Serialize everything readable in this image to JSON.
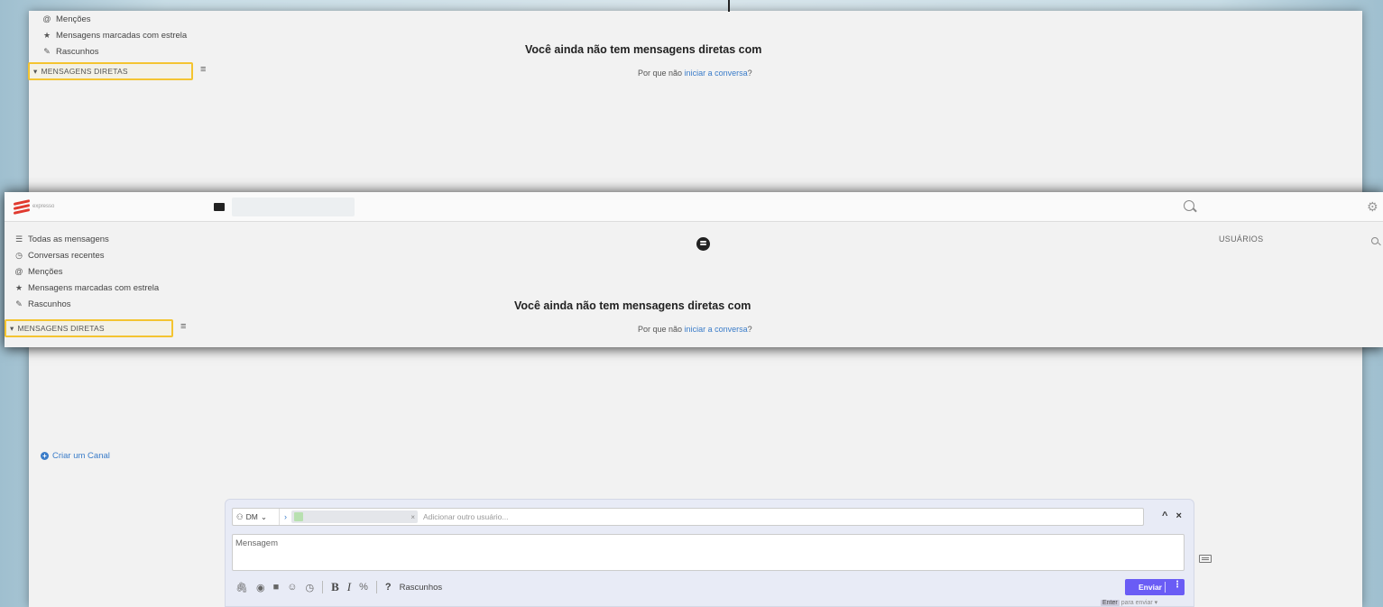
{
  "background": {
    "nav": [
      {
        "icon": "at-icon",
        "glyph": "@",
        "label": "Menções"
      },
      {
        "icon": "star-icon",
        "glyph": "★",
        "label": "Mensagens marcadas com estrela"
      },
      {
        "icon": "pencil-icon",
        "glyph": "✎",
        "label": "Rascunhos"
      }
    ],
    "dm_header": "MENSAGENS DIRETAS",
    "empty_title": "Você ainda não tem mensagens diretas com",
    "empty_prefix": "Por que não",
    "empty_link": "iniciar a conversa",
    "empty_suffix": "?"
  },
  "overlay": {
    "logo_text": "expresso",
    "nav": [
      {
        "icon": "list-icon",
        "glyph": "☰",
        "label": "Todas as mensagens"
      },
      {
        "icon": "clock-icon",
        "glyph": "◷",
        "label": "Conversas recentes"
      },
      {
        "icon": "at-icon",
        "glyph": "@",
        "label": "Menções"
      },
      {
        "icon": "star-icon",
        "glyph": "★",
        "label": "Mensagens marcadas com estrela"
      },
      {
        "icon": "pencil-icon",
        "glyph": "✎",
        "label": "Rascunhos"
      }
    ],
    "dm_header": "MENSAGENS DIRETAS",
    "users_label": "USUÁRIOS",
    "empty_title": "Você ainda não tem mensagens diretas com",
    "empty_prefix": "Por que não",
    "empty_link": "iniciar a conversa",
    "empty_suffix": "?"
  },
  "sidebar": {
    "create_channel": "Criar um Canal"
  },
  "compose": {
    "dm_select": "DM",
    "add_user_placeholder": "Adicionar outro usuário...",
    "message_placeholder": "Mensagem",
    "drafts_label": "Rascunhos",
    "send_label": "Enviar",
    "enter_key": "Enter",
    "enter_hint": "para enviar ▾",
    "collapse_controls": "^ ×"
  },
  "colors": {
    "accent": "#6a5cf5",
    "link": "#3a7cc9",
    "highlight": "#f4c430",
    "brand": "#e03a2f"
  }
}
